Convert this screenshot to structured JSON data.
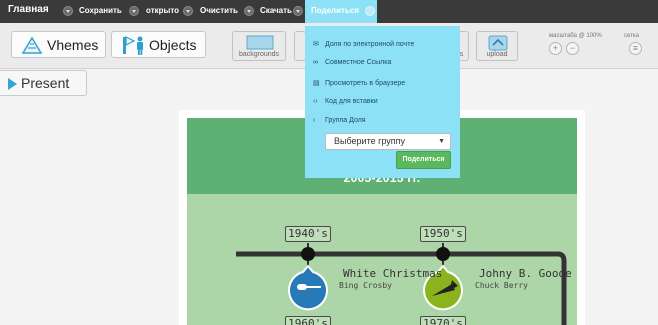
{
  "menu": {
    "items": [
      {
        "label": "Главная"
      },
      {
        "label": "Сохранить"
      },
      {
        "label": "открыто"
      },
      {
        "label": "Очистить"
      },
      {
        "label": "Скачать"
      }
    ],
    "share_label": "Поделиться"
  },
  "toolbar": {
    "themes_label": "Vhemes",
    "objects_label": "Objects",
    "backgrounds_label": "backgrounds",
    "right_btn_label": "s",
    "upload_label": "upload",
    "scale_label": "масштаба @ 100%",
    "grid_label": "сетка",
    "zoom_in": "+",
    "zoom_out": "−",
    "grid_symbol": "≡"
  },
  "present_label": "Present",
  "share_menu": {
    "items": [
      {
        "icon": "envelope-icon",
        "label": "Доля по электронной почте"
      },
      {
        "icon": "link-icon",
        "label": "Совместное Ссылка"
      },
      {
        "icon": "browser-icon",
        "label": "Просмотреть в браузере"
      },
      {
        "icon": "code-icon",
        "label": "Код для вставки"
      },
      {
        "icon": "share-icon",
        "label": "Группа Доля"
      }
    ],
    "select_value": "Выберите группу",
    "share_button": "Поделиться"
  },
  "canvas": {
    "years_title": "2005-2015 гг.",
    "entries": [
      {
        "decade": "1940's",
        "song": "White Christmas",
        "artist": "Bing Crosby"
      },
      {
        "decade": "1950's",
        "song": "Johny B. Goode",
        "artist": "Chuck Berry"
      },
      {
        "decade": "1960's"
      },
      {
        "decade": "1970's"
      }
    ]
  },
  "colors": {
    "menubar": "#3a3a3a",
    "share_panel": "#8de1f6",
    "header_green": "#5fb074",
    "body_green": "#add6a8",
    "badge_blue": "#2879b8",
    "badge_lime": "#8bb31e",
    "share_button": "#5cb85c"
  }
}
